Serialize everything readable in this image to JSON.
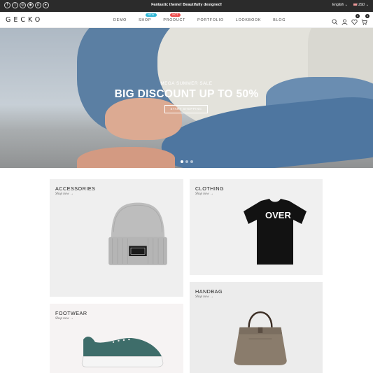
{
  "topbar": {
    "socials": [
      {
        "icon": "facebook-icon",
        "glyph": "f"
      },
      {
        "icon": "twitter-icon",
        "glyph": "t"
      },
      {
        "icon": "instagram-icon",
        "glyph": "◎"
      },
      {
        "icon": "dribbble-icon",
        "glyph": "◉"
      },
      {
        "icon": "pinterest-icon",
        "glyph": "p"
      },
      {
        "icon": "youtube-icon",
        "glyph": "▸"
      }
    ],
    "announcement": "Fantastic theme! Beautifully designed!",
    "language": "English ⌄",
    "currency": "USD ⌄"
  },
  "header": {
    "logo": "GECKO",
    "nav": [
      {
        "label": "DEMO"
      },
      {
        "label": "SHOP",
        "badge": "NEW",
        "badge_color": "#31b7d6"
      },
      {
        "label": "PRODUCT",
        "badge": "HOT",
        "badge_color": "#ee4d4d"
      },
      {
        "label": "PORTFOLIO"
      },
      {
        "label": "LOOKBOOK"
      },
      {
        "label": "BLOG"
      }
    ],
    "icons": [
      "search-icon",
      "user-icon",
      "wishlist-icon",
      "cart-icon"
    ],
    "wishlist_count": "0",
    "cart_count": "0"
  },
  "hero": {
    "kicker": "MEGA SUMMER SALE",
    "title": "BIG DISCOUNT UP TO 50%",
    "button": "START SHOPPING",
    "slides": 3,
    "active_slide": 1
  },
  "collections": [
    {
      "title": "ACCESSORIES",
      "link": "Shop now →"
    },
    {
      "title": "CLOTHING",
      "link": "Shop now →"
    },
    {
      "title": "FOOTWEAR",
      "link": "Shop now →"
    },
    {
      "title": "HANDBAG",
      "link": "Shop now →"
    }
  ],
  "colors": {
    "topbar": "#2b2b2b",
    "new_badge": "#31b7d6",
    "hot_badge": "#ee4d4d",
    "card_bg": "#f0f0f0"
  }
}
